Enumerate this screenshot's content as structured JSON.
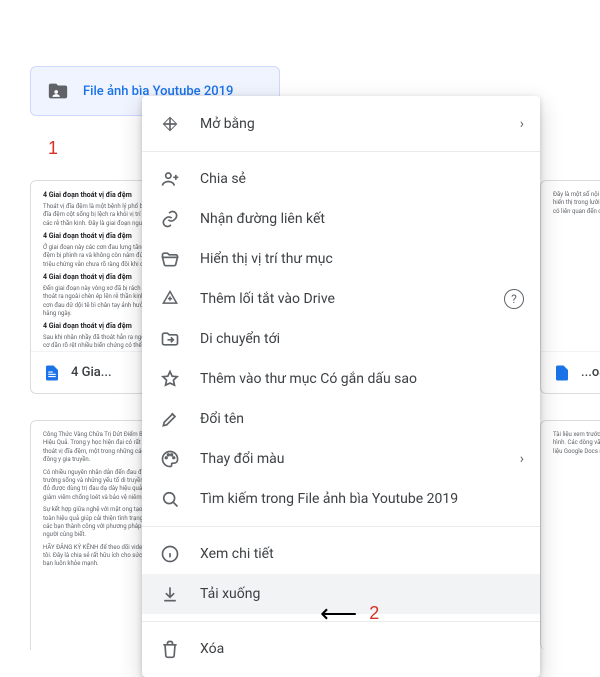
{
  "folder": {
    "name": "File ảnh bìa Youtube 2019"
  },
  "annotations": {
    "one": "1",
    "two": "2"
  },
  "doc": {
    "title": "4 Gia..."
  },
  "previewHeading": "4 Giai đoạn thoát vị đĩa đệm",
  "menu": {
    "open_with": "Mở bằng",
    "share": "Chia sẻ",
    "get_link": "Nhận đường liên kết",
    "show_location": "Hiển thị vị trí thư mục",
    "add_shortcut": "Thêm lối tắt vào Drive",
    "move_to": "Di chuyển tới",
    "add_star": "Thêm vào thư mục Có gắn dấu sao",
    "rename": "Đổi tên",
    "change_color": "Thay đổi màu",
    "search_within_prefix": "Tìm kiếm trong ",
    "view_details": "Xem chi tiết",
    "download": "Tải xuống",
    "remove": "Xóa"
  }
}
